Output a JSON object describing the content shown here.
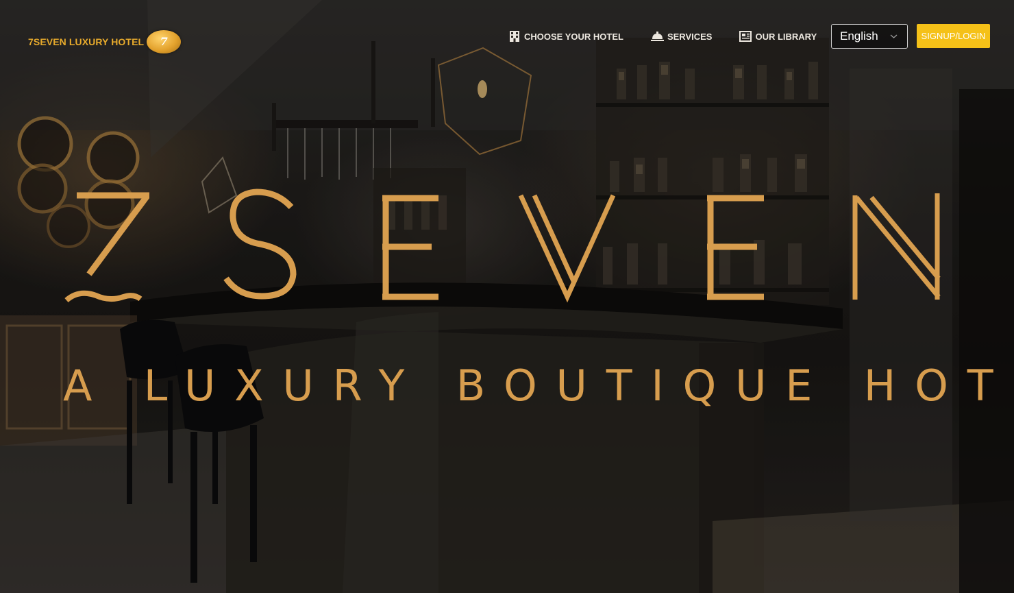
{
  "header": {
    "logo_text": "7SEVEN LUXURY HOTEL",
    "logo_badge_mark": "7",
    "nav": [
      {
        "label": "CHOOSE YOUR HOTEL",
        "icon": "building-icon"
      },
      {
        "label": "SERVICES",
        "icon": "service-bell-icon"
      },
      {
        "label": "OUR LIBRARY",
        "icon": "newspaper-icon"
      }
    ],
    "language": {
      "selected": "English"
    },
    "signup_label": "SIGNUP/LOGIN"
  },
  "hero": {
    "tagline": "A LUXURY BOUTIQUE HOTEL",
    "wordmark_letters": [
      "S",
      "E",
      "V",
      "E",
      "N"
    ]
  },
  "colors": {
    "brand_gold": "#e7aa2c",
    "wordmark_gold": "#d79d4e",
    "signup_yellow": "#f5c118"
  }
}
